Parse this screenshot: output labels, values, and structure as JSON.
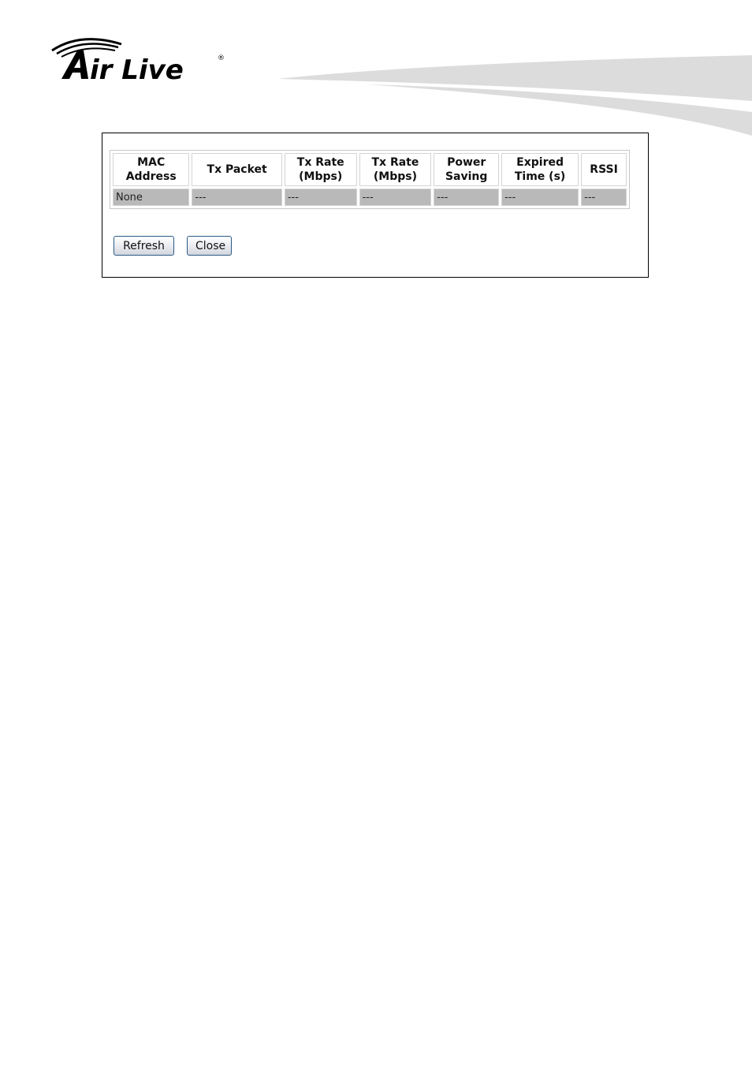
{
  "brand": {
    "name": "Air Live",
    "registered_mark": "®",
    "logo_text_color": "#000000",
    "swoosh_color": "#dcdcdc"
  },
  "station_table": {
    "columns": [
      {
        "line1": "MAC",
        "line2": "Address"
      },
      {
        "line1": "Tx Packet",
        "line2": ""
      },
      {
        "line1": "Tx Rate",
        "line2": "(Mbps)"
      },
      {
        "line1": "Tx Rate",
        "line2": "(Mbps)"
      },
      {
        "line1": "Power",
        "line2": "Saving"
      },
      {
        "line1": "Expired",
        "line2": "Time (s)"
      },
      {
        "line1": "RSSI",
        "line2": ""
      }
    ],
    "rows": [
      [
        "None",
        "---",
        "---",
        "---",
        "---",
        "---",
        "---"
      ]
    ],
    "row_background": "#b9b9b9"
  },
  "buttons": {
    "refresh_label": "Refresh",
    "close_label": "Close"
  }
}
